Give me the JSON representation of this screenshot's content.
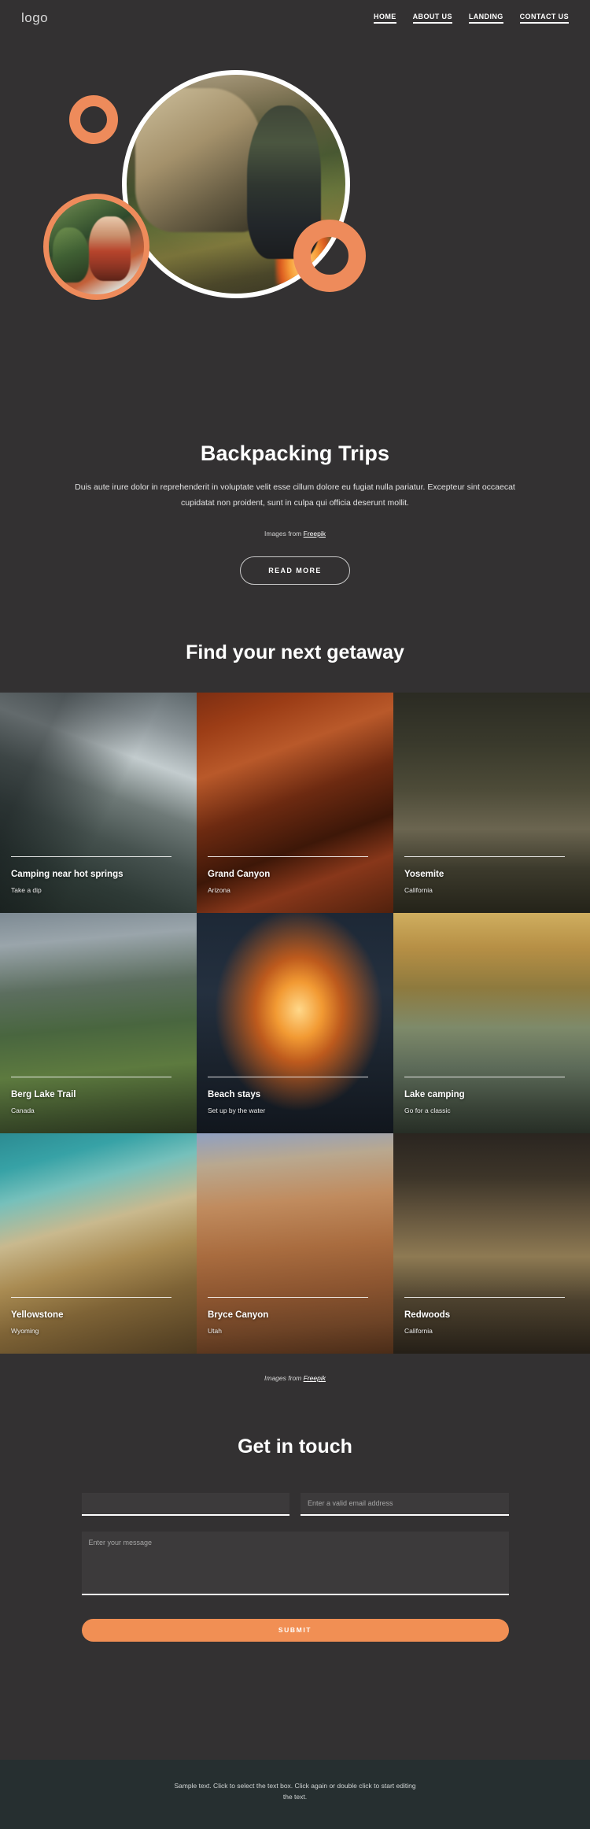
{
  "header": {
    "logo": "logo",
    "nav": [
      {
        "label": "HOME"
      },
      {
        "label": "ABOUT US"
      },
      {
        "label": "LANDING"
      },
      {
        "label": "CONTACT US"
      }
    ]
  },
  "hero": {
    "title": "Backpacking Trips",
    "paragraph": "Duis aute irure dolor in reprehenderit in voluptate velit esse cillum dolore eu fugiat nulla pariatur. Excepteur sint occaecat cupidatat non proident, sunt in culpa qui officia deserunt mollit.",
    "credit_prefix": "Images from ",
    "credit_link": "Freepik",
    "cta": "READ MORE"
  },
  "gallery": {
    "heading": "Find your next getaway",
    "credit_prefix": "Images from ",
    "credit_link": "Freepik",
    "tiles": [
      {
        "title": "Camping near hot springs",
        "subtitle": "Take a dip"
      },
      {
        "title": "Grand Canyon",
        "subtitle": "Arizona"
      },
      {
        "title": "Yosemite",
        "subtitle": "California"
      },
      {
        "title": "Berg Lake Trail",
        "subtitle": "Canada"
      },
      {
        "title": "Beach stays",
        "subtitle": "Set up by the water"
      },
      {
        "title": "Lake camping",
        "subtitle": "Go for a classic"
      },
      {
        "title": "Yellowstone",
        "subtitle": "Wyoming"
      },
      {
        "title": "Bryce Canyon",
        "subtitle": "Utah"
      },
      {
        "title": "Redwoods",
        "subtitle": "California"
      }
    ]
  },
  "contact": {
    "title": "Get in touch",
    "name_value": "",
    "name_placeholder": "",
    "email_placeholder": "Enter a valid email address",
    "message_placeholder": "Enter your message",
    "submit_label": "SUBMIT"
  },
  "footer": {
    "text": "Sample text. Click to select the text box. Click again or double click to start editing the text."
  },
  "colors": {
    "background": "#333132",
    "accent_orange": "#ee8b5b",
    "submit_orange": "#f18f54",
    "footer_background": "#262f30"
  }
}
